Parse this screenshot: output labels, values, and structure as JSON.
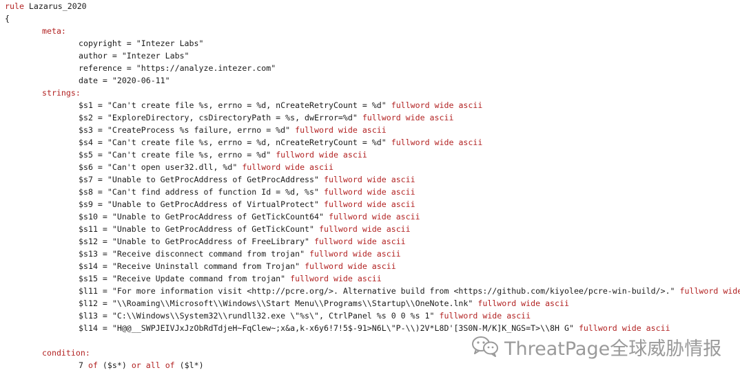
{
  "rule_header": "rule Lazarus_2020",
  "open_brace": "{",
  "meta_label": "meta:",
  "meta": [
    "copyright = \"Intezer Labs\"",
    "author = \"Intezer Labs\"",
    "reference = \"https://analyze.intezer.com\"",
    "date = \"2020-06-11\""
  ],
  "strings_label": "strings:",
  "modifiers": "fullword wide ascii",
  "strings": [
    "$s1 = \"Can't create file %s, errno = %d, nCreateRetryCount = %d\"",
    "$s2 = \"ExploreDirectory, csDirectoryPath = %s, dwError=%d\"",
    "$s3 = \"CreateProcess %s failure, errno = %d\"",
    "$s4 = \"Can't create file %s, errno = %d, nCreateRetryCount = %d\"",
    "$s5 = \"Can't create file %s, errno = %d\"",
    "$s6 = \"Can't open user32.dll, %d\"",
    "$s7 = \"Unable to GetProcAddress of GetProcAddress\"",
    "$s8 = \"Can't find address of function Id = %d, %s\"",
    "$s9 = \"Unable to GetProcAddress of VirtualProtect\"",
    "$s10 = \"Unable to GetProcAddress of GetTickCount64\"",
    "$s11 = \"Unable to GetProcAddress of GetTickCount\"",
    "$s12 = \"Unable to GetProcAddress of FreeLibrary\"",
    "$s13 = \"Receive disconnect command from trojan\"",
    "$s14 = \"Receive Uninstall command from Trojan\"",
    "$s15 = \"Receive Update command from trojan\"",
    "$l11 = \"For more information visit <http://pcre.org/>. Alternative build from <https://github.com/kiyolee/pcre-win-build/>.\"",
    "$l12 = \"\\\\Roaming\\\\Microsoft\\\\Windows\\\\Start Menu\\\\Programs\\\\Startup\\\\OneNote.lnk\"",
    "$l13 = \"C:\\\\Windows\\\\System32\\\\rundll32.exe \\\"%s\\\", CtrlPanel %s 0 0 %s 1\"",
    "$l14 = \"H@@__SWPJEIVJxJzObRdTdjeH~FqClew~;x&a,k-x6y6!7!5$-91>N6L\\\"P-\\\\)2V*L8D'[3S0N-M/K]K_NGS=T>\\\\8H G\""
  ],
  "condition_label": "condition:",
  "condition": {
    "count": "7",
    "of1": "of",
    "s_set": "($s*)",
    "or": "or",
    "all": "all",
    "of2": "of",
    "l_set": "($l*)"
  },
  "watermark": {
    "icon": "wechat-icon",
    "text": "ThreatPage全球威胁情报"
  },
  "colors": {
    "keyword": "#b22222",
    "text": "#1a1a1a",
    "watermark": "#9a9a9a"
  }
}
